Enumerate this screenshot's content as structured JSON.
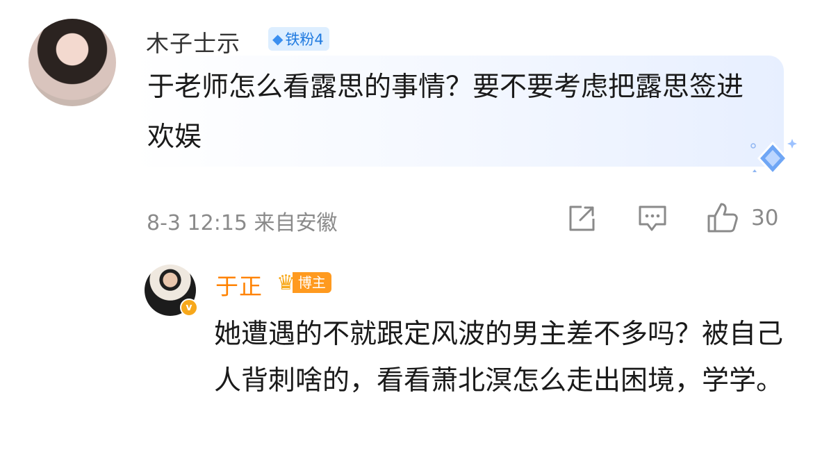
{
  "comment": {
    "username": "木子士示",
    "fan_badge": "铁粉4",
    "text": "于老师怎么看露思的事情？要不要考虑把露思签进欢娱",
    "time": "8-3 12:15",
    "location": "来自安徽",
    "like_count": "30",
    "icons": [
      "share-icon",
      "comment-icon",
      "like-icon",
      "diamond-icon"
    ]
  },
  "reply": {
    "username": "于正",
    "badge": "博主",
    "text": "她遭遇的不就跟定风波的男主差不多吗？被自己人背刺啥的，看看萧北溟怎么走出困境，学学。",
    "icons": [
      "crown-icon",
      "verified-icon"
    ]
  },
  "colors": {
    "username_gray": "#333333",
    "author_orange": "#ff8200",
    "meta_gray": "#8a8a8a",
    "fan_badge_bg": "#ddeeff",
    "fan_badge_text": "#1f7ae0",
    "blogger_badge_bg": "#ff9a1f"
  }
}
